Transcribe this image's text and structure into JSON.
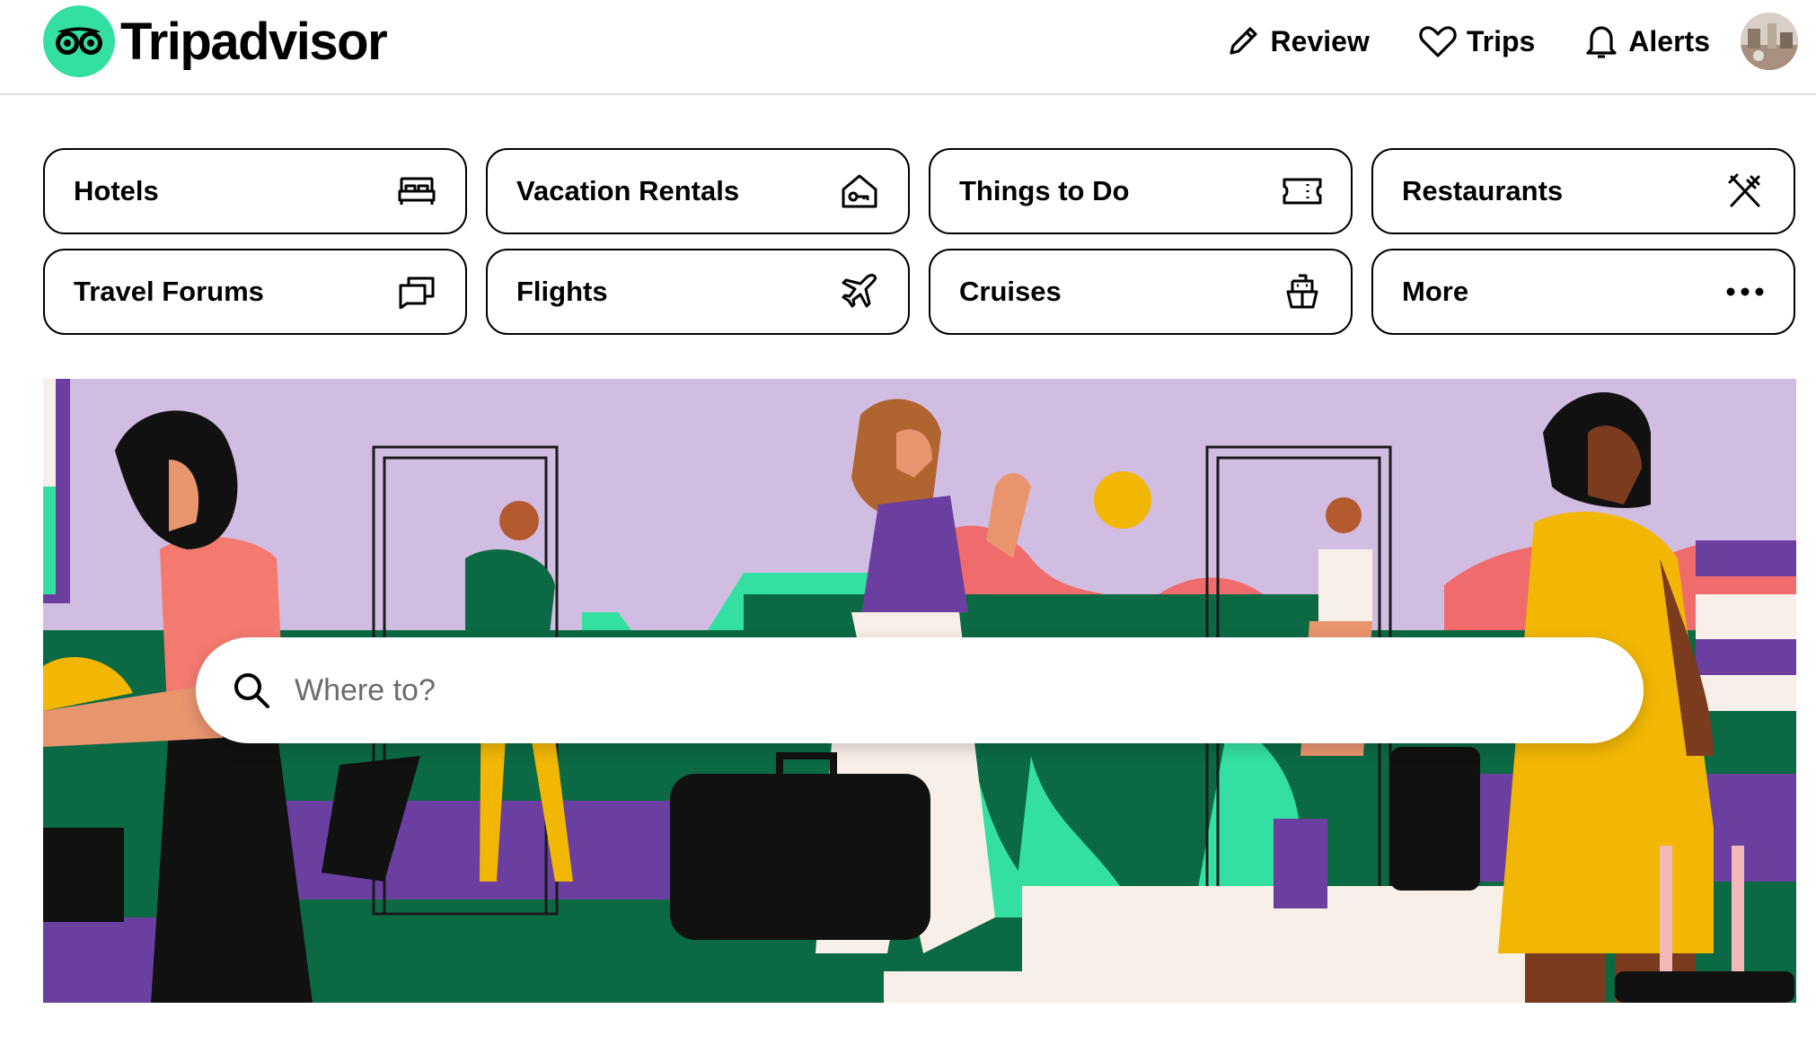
{
  "header": {
    "brand": "Tripadvisor",
    "nav": [
      {
        "label": "Review",
        "icon": "pencil-icon"
      },
      {
        "label": "Trips",
        "icon": "heart-icon"
      },
      {
        "label": "Alerts",
        "icon": "bell-icon"
      }
    ]
  },
  "categories": [
    {
      "label": "Hotels",
      "icon": "bed-icon"
    },
    {
      "label": "Vacation Rentals",
      "icon": "house-key-icon"
    },
    {
      "label": "Things to Do",
      "icon": "ticket-icon"
    },
    {
      "label": "Restaurants",
      "icon": "fork-knife-icon"
    },
    {
      "label": "Travel Forums",
      "icon": "chat-bubbles-icon"
    },
    {
      "label": "Flights",
      "icon": "airplane-icon"
    },
    {
      "label": "Cruises",
      "icon": "ship-icon"
    },
    {
      "label": "More",
      "icon": "more-dots-icon"
    }
  ],
  "search": {
    "placeholder": "Where to?",
    "value": ""
  },
  "colors": {
    "brand_green": "#34e0a1",
    "hero_lavender": "#d2bde2",
    "hero_green": "#0b6a44",
    "hero_mint": "#34e0a1",
    "hero_purple": "#6b3fa0",
    "hero_coral": "#f06b6b",
    "hero_yellow": "#f2b705"
  }
}
